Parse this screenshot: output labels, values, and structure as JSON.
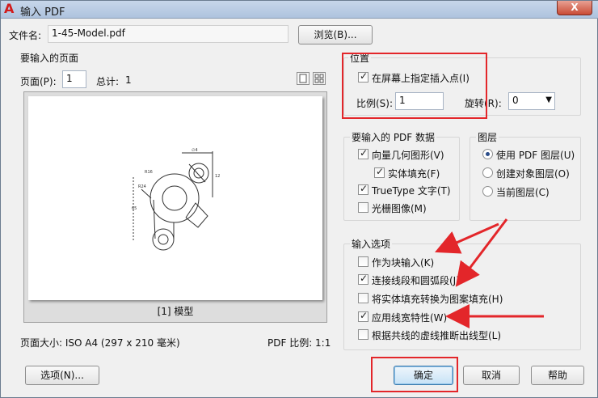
{
  "window": {
    "title": "输入 PDF",
    "close_label": "X"
  },
  "file": {
    "label": "文件名:",
    "value": "1-45-Model.pdf",
    "browse_label": "浏览(B)..."
  },
  "pages": {
    "group_label": "要输入的页面",
    "page_label": "页面(P):",
    "page_value": "1",
    "total_label": "总计:",
    "total_value": "1",
    "preview_caption": "[1] 模型",
    "page_size": "页面大小: ISO A4 (297 x 210 毫米)",
    "pdf_scale": "PDF 比例: 1:1"
  },
  "position": {
    "group_label": "位置",
    "onscreen_label": "在屏幕上指定插入点(I)",
    "onscreen_checked": true,
    "scale_label": "比例(S):",
    "scale_value": "1",
    "rotate_label": "旋转(R):",
    "rotate_value": "0"
  },
  "pdf_data": {
    "group_label": "要输入的 PDF 数据",
    "items": [
      {
        "label": "向量几何图形(V)",
        "checked": true
      },
      {
        "label": "实体填充(F)",
        "checked": true
      },
      {
        "label": "TrueType 文字(T)",
        "checked": true
      },
      {
        "label": "光栅图像(M)",
        "checked": false
      }
    ]
  },
  "layers": {
    "group_label": "图层",
    "items": [
      {
        "label": "使用 PDF 图层(U)",
        "checked": true
      },
      {
        "label": "创建对象图层(O)",
        "checked": false
      },
      {
        "label": "当前图层(C)",
        "checked": false
      }
    ]
  },
  "import_options": {
    "group_label": "输入选项",
    "items": [
      {
        "label": "作为块输入(K)",
        "checked": false
      },
      {
        "label": "连接线段和圆弧段(J)",
        "checked": true
      },
      {
        "label": "将实体填充转换为图案填充(H)",
        "checked": false
      },
      {
        "label": "应用线宽特性(W)",
        "checked": true
      },
      {
        "label": "根据共线的虚线推断出线型(L)",
        "checked": false
      }
    ]
  },
  "buttons": {
    "options": "选项(N)...",
    "ok": "确定",
    "cancel": "取消",
    "help": "帮助"
  },
  "annotation_color": "#e3262a"
}
